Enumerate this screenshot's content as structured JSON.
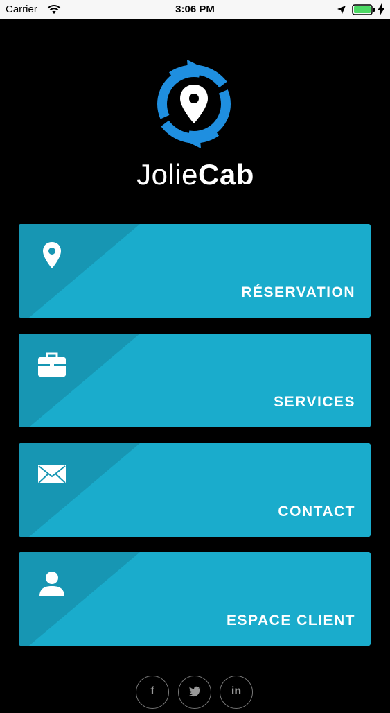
{
  "status_bar": {
    "carrier": "Carrier",
    "time": "3:06 PM"
  },
  "brand": {
    "name_light": "Jolie",
    "name_bold": "Cab",
    "accent_color": "#1f8fe0"
  },
  "menu": [
    {
      "label": "RÉSERVATION",
      "icon": "location-pin-icon"
    },
    {
      "label": "SERVICES",
      "icon": "briefcase-icon"
    },
    {
      "label": "CONTACT",
      "icon": "envelope-icon"
    },
    {
      "label": "ESPACE CLIENT",
      "icon": "user-icon"
    }
  ],
  "tile_color": "#1aaccc",
  "social": {
    "facebook": "f",
    "twitter": "🐦",
    "linkedin": "in"
  }
}
